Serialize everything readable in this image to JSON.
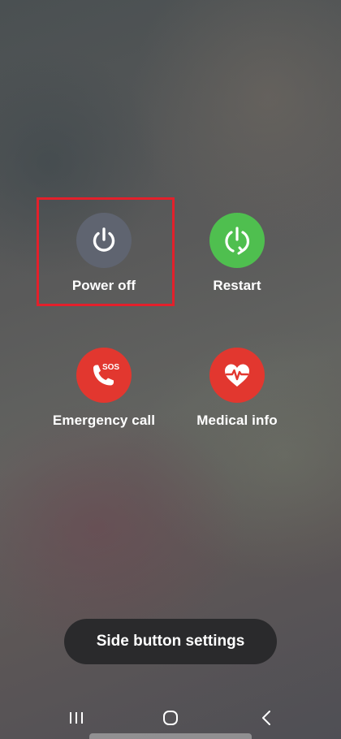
{
  "power_menu": {
    "power_off": {
      "label": "Power off",
      "icon": "power-icon",
      "color": "#5f6470"
    },
    "restart": {
      "label": "Restart",
      "icon": "restart-icon",
      "color": "#4fbf4f"
    },
    "emergency_call": {
      "label": "Emergency call",
      "icon": "phone-sos-icon",
      "badge": "SOS",
      "color": "#e2372f"
    },
    "medical_info": {
      "label": "Medical info",
      "icon": "heart-pulse-icon",
      "color": "#e2372f"
    }
  },
  "side_button_settings": {
    "label": "Side button settings"
  },
  "highlight": {
    "color": "#e3202b"
  },
  "navigation_bar": {
    "recents": "recents-icon",
    "home": "home-icon",
    "back": "back-icon"
  }
}
